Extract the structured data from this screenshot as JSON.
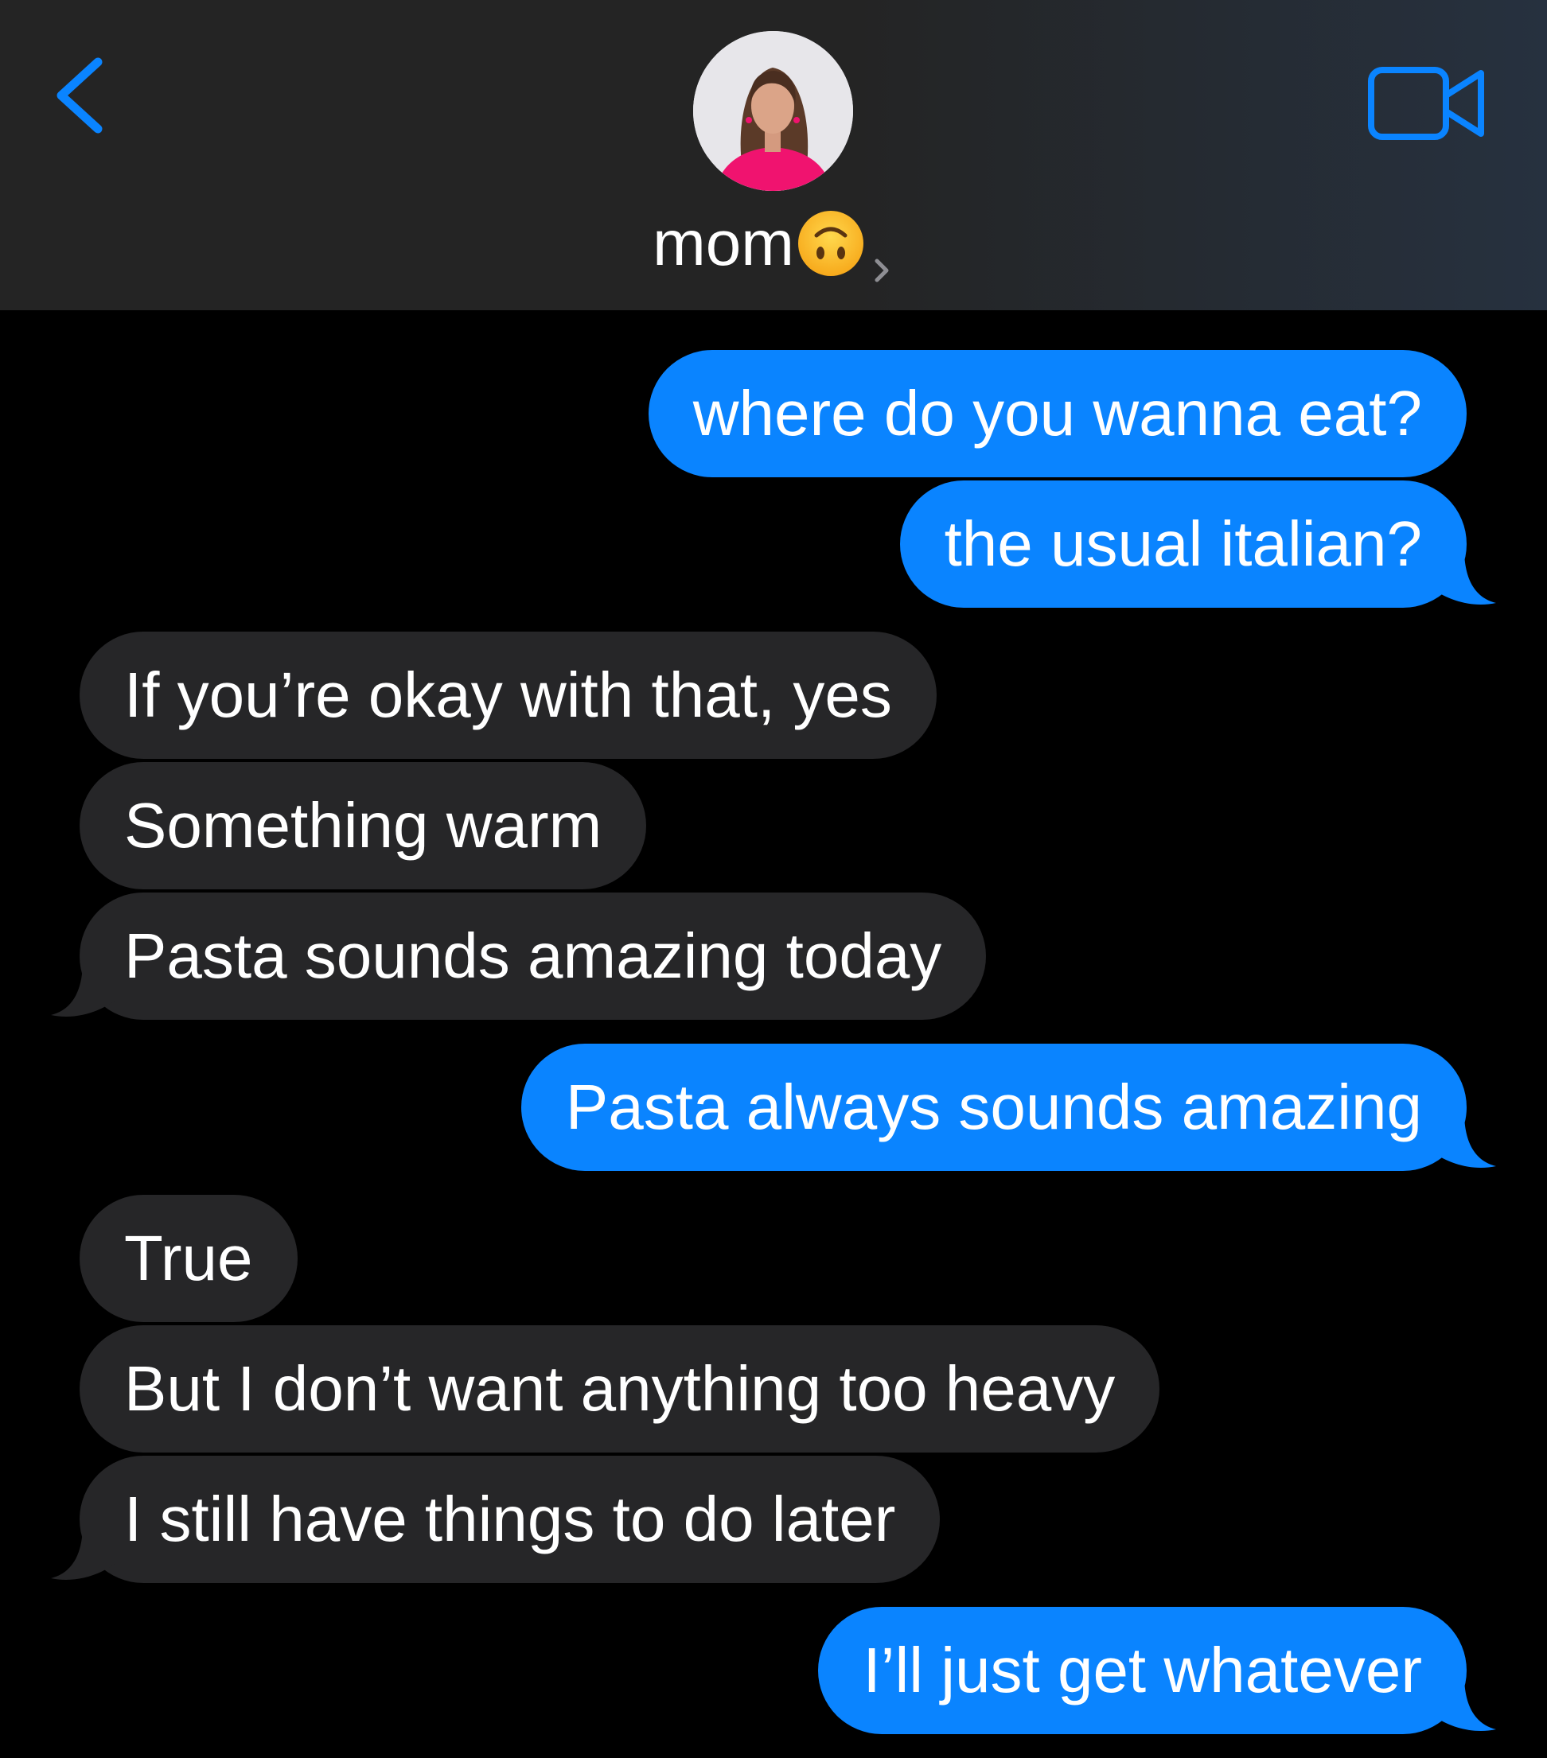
{
  "header": {
    "contact_name": "mom",
    "contact_emoji_icon": "upside-down-face-icon",
    "back_icon": "chevron-left-icon",
    "video_icon": "video-camera-icon",
    "accent_color": "#0a84ff"
  },
  "messages": [
    {
      "direction": "sent",
      "text": "where do you wanna eat?"
    },
    {
      "direction": "sent",
      "text": "the usual italian?"
    },
    {
      "direction": "received",
      "text": "If you’re okay with that, yes"
    },
    {
      "direction": "received",
      "text": "Something warm"
    },
    {
      "direction": "received",
      "text": "Pasta sounds amazing today"
    },
    {
      "direction": "sent",
      "text": "Pasta always sounds amazing"
    },
    {
      "direction": "received",
      "text": "True"
    },
    {
      "direction": "received",
      "text": "But I don’t want anything too heavy"
    },
    {
      "direction": "received",
      "text": "I still have things to do later"
    },
    {
      "direction": "sent",
      "text": "I’ll just get whatever"
    }
  ],
  "colors": {
    "sent_bubble": "#0a84ff",
    "received_bubble": "#262628",
    "background": "#000000",
    "header_background": "#242424"
  }
}
